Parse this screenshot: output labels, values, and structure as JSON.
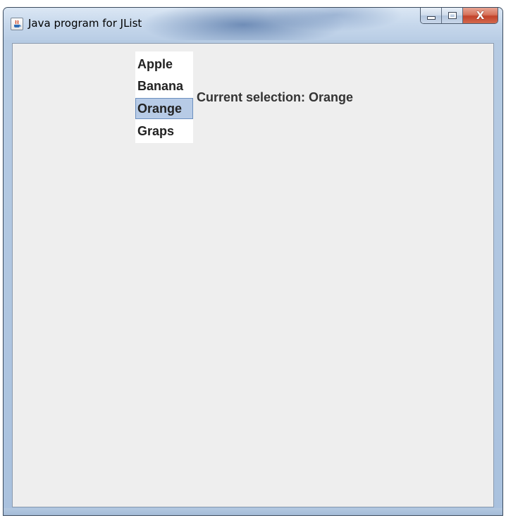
{
  "window": {
    "title": "Java program for JList",
    "controls": {
      "minimize_icon": "minimize-icon",
      "maximize_icon": "maximize-icon",
      "close_glyph": "X"
    }
  },
  "list": {
    "items": [
      "Apple",
      "Banana",
      "Orange",
      "Graps"
    ],
    "selected_index": 2
  },
  "selection": {
    "label": "Current selection:",
    "value": "Orange"
  },
  "colors": {
    "selection_bg": "#b7cbe6",
    "selection_border": "#6b8fbf",
    "client_bg": "#eeeeee",
    "close_button": "#c2422a"
  }
}
